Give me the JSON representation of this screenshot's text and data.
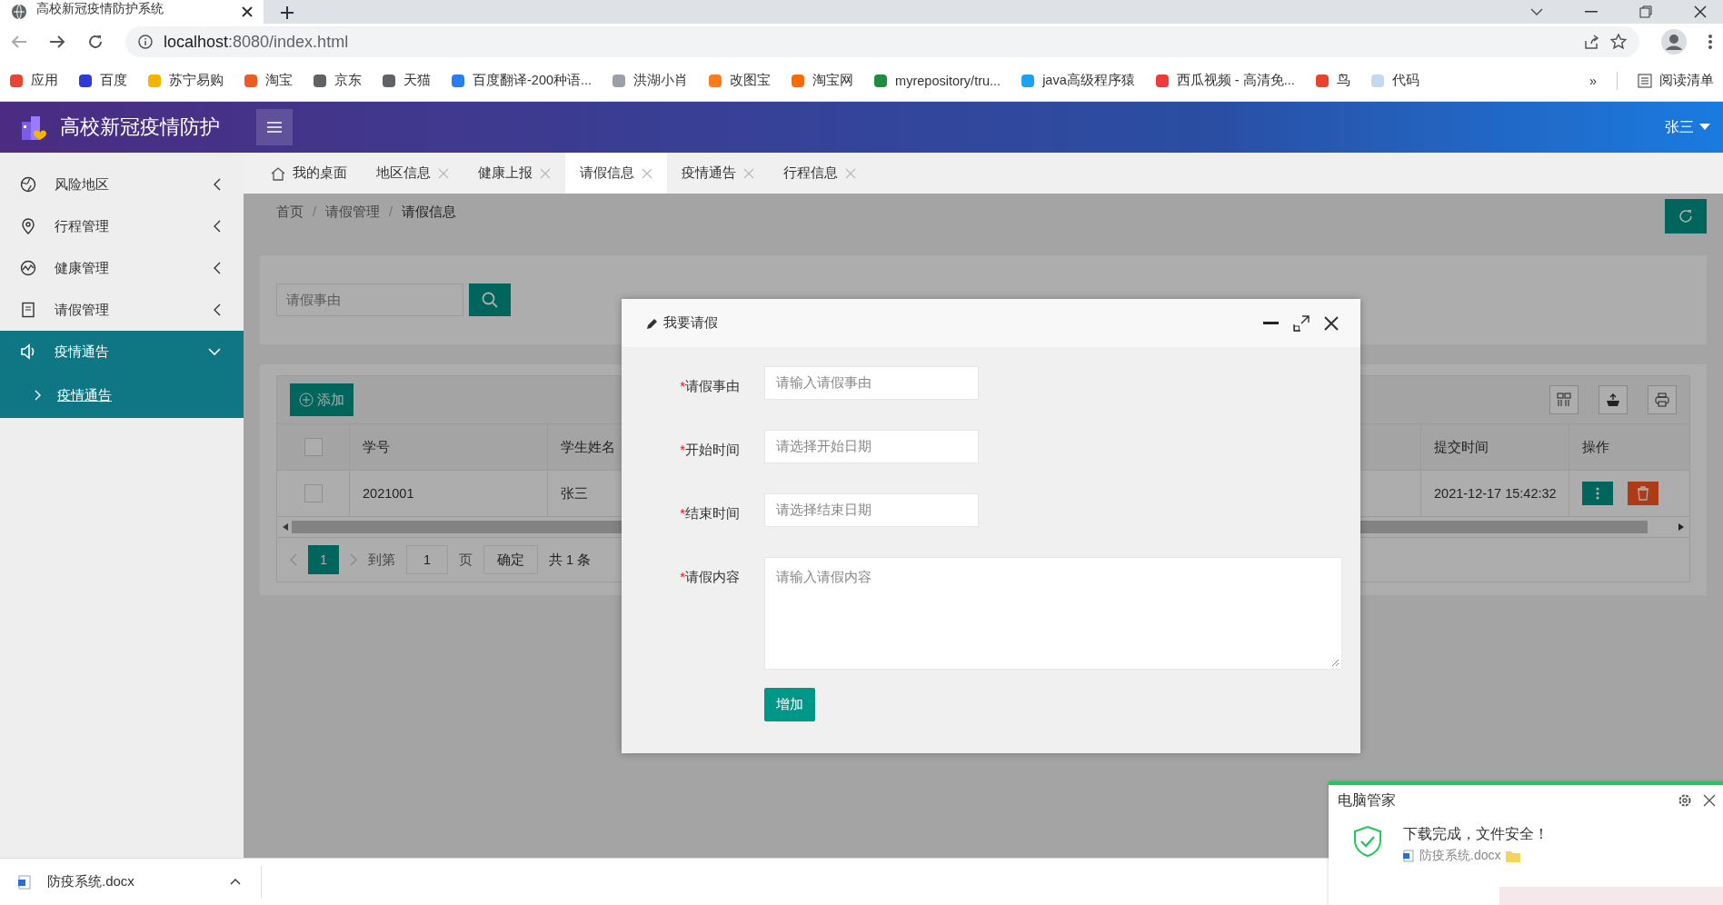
{
  "browser": {
    "tab_title": "高校新冠疫情防护系统",
    "url_host": "localhost",
    "url_rest": ":8080/index.html"
  },
  "bookmarks": [
    {
      "label": "应用",
      "color": "#e94335"
    },
    {
      "label": "百度",
      "color": "#2f39d8"
    },
    {
      "label": "苏宁易购",
      "color": "#f5b400"
    },
    {
      "label": "淘宝",
      "color": "#ee5a24"
    },
    {
      "label": "京东",
      "color": "#5f6368"
    },
    {
      "label": "天猫",
      "color": "#5f6368"
    },
    {
      "label": "百度翻译-200种语...",
      "color": "#2b7cf0"
    },
    {
      "label": "洪湖小肖",
      "color": "#9aa0a6"
    },
    {
      "label": "改图宝",
      "color": "#ff7a1a"
    },
    {
      "label": "淘宝网",
      "color": "#ff6a00"
    },
    {
      "label": "myrepository/tru...",
      "color": "#1e8e3e"
    },
    {
      "label": "java高级程序猿",
      "color": "#1da1f2"
    },
    {
      "label": "西瓜视频 - 高清免...",
      "color": "#f03a3a"
    },
    {
      "label": "鸟",
      "color": "#e8442c"
    },
    {
      "label": "代码",
      "color": "#c5d8f0"
    }
  ],
  "bookmarks_more": "»",
  "reading_list": "阅读清单",
  "app": {
    "title": "高校新冠疫情防护",
    "user": "张三"
  },
  "sidebar": {
    "items": [
      {
        "label": "风险地区",
        "expanded": false
      },
      {
        "label": "行程管理",
        "expanded": false
      },
      {
        "label": "健康管理",
        "expanded": false
      },
      {
        "label": "请假管理",
        "expanded": false
      },
      {
        "label": "疫情通告",
        "expanded": true,
        "children": [
          {
            "label": "疫情通告",
            "selected": true
          }
        ]
      }
    ]
  },
  "tabs": [
    {
      "label": "我的桌面",
      "kind": "home",
      "selected": false
    },
    {
      "label": "地区信息",
      "kind": "page",
      "selected": false
    },
    {
      "label": "健康上报",
      "kind": "page",
      "selected": false
    },
    {
      "label": "请假信息",
      "kind": "page",
      "selected": true
    },
    {
      "label": "疫情通告",
      "kind": "page",
      "selected": false
    },
    {
      "label": "行程信息",
      "kind": "page",
      "selected": false
    }
  ],
  "breadcrumb": [
    {
      "label": "首页",
      "kind": "link"
    },
    {
      "label": "/",
      "kind": "separator"
    },
    {
      "label": "请假管理",
      "kind": "link"
    },
    {
      "label": "/",
      "kind": "separator"
    },
    {
      "label": "请假信息",
      "kind": "current"
    }
  ],
  "search": {
    "placeholder": "请假事由"
  },
  "toolbar": {
    "add_label": "添加"
  },
  "table": {
    "header_checked": false,
    "columns": [
      "学号",
      "学生姓名",
      "提交时间",
      "操作"
    ],
    "rows": [
      {
        "checked": false,
        "cells": [
          "2021001",
          "张三",
          "2021-12-17 15:42:32"
        ]
      }
    ]
  },
  "pagination": {
    "pages": [
      {
        "label": "1",
        "selected": true
      }
    ],
    "goto_label": "到第",
    "goto_value": "1",
    "page_unit": "页",
    "confirm": "确定",
    "total": "共 1 条"
  },
  "dialog": {
    "title": "我要请假",
    "submit": "增加",
    "fields": [
      {
        "marker": "*",
        "label": "请假事由",
        "kind": "input",
        "placeholder": "请输入请假事由"
      },
      {
        "marker": "*",
        "label": "开始时间",
        "kind": "input",
        "placeholder": "请选择开始日期"
      },
      {
        "marker": "*",
        "label": "结束时间",
        "kind": "input",
        "placeholder": "请选择结束日期"
      },
      {
        "marker": "*",
        "label": "请假内容",
        "kind": "textarea",
        "placeholder": "请输入请假内容"
      }
    ]
  },
  "downloads": {
    "file": "防疫系统.docx"
  },
  "notification": {
    "title": "电脑管家",
    "message": "下载完成，文件安全！",
    "file": "防疫系统.docx"
  }
}
